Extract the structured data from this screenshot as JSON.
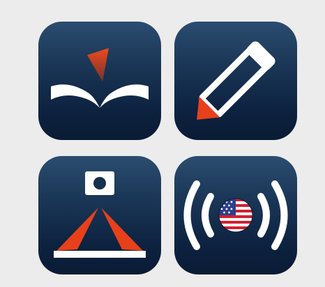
{
  "background": "#ececec",
  "icon_colors": {
    "gradient_top": "#2b4d70",
    "gradient_bottom": "#0a1b34",
    "accent": "#e8401b",
    "white": "#ffffff",
    "flag_red": "#d21f2f",
    "flag_blue": "#2c3f8c"
  },
  "apps": [
    {
      "icon": "open-book-icon"
    },
    {
      "icon": "pencil-icon"
    },
    {
      "icon": "document-camera-icon"
    },
    {
      "icon": "us-audio-broadcast-icon"
    }
  ]
}
